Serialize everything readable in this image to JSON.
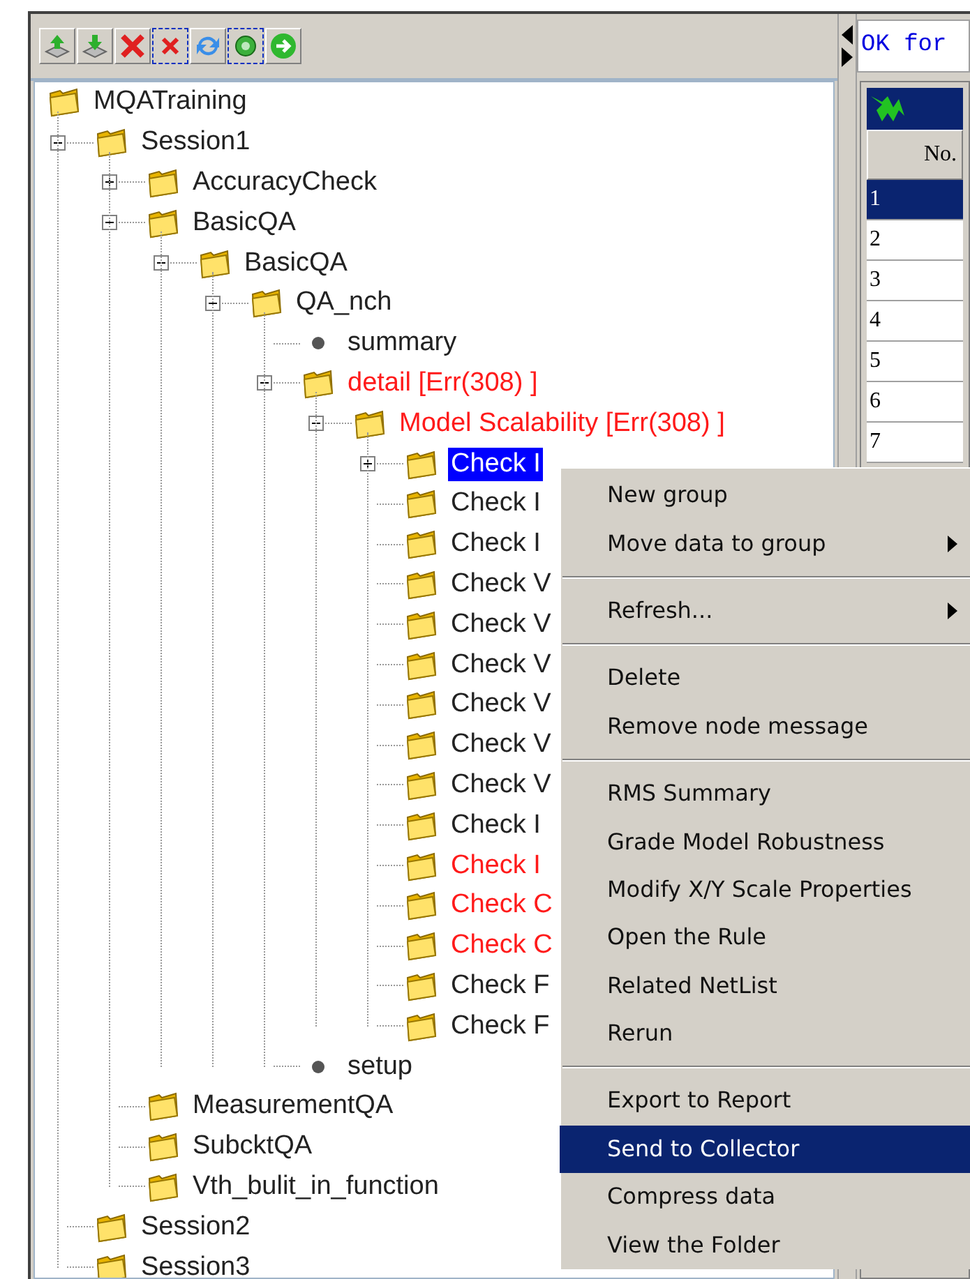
{
  "tree": [
    {
      "label": "MQATraining",
      "kind": "folder",
      "error": false,
      "children": [
        {
          "label": "Session1",
          "kind": "folder",
          "error": false,
          "expanded": true,
          "children": [
            {
              "label": "AccuracyCheck",
              "kind": "folder",
              "error": false,
              "expanded": false
            },
            {
              "label": "BasicQA",
              "kind": "folder",
              "error": false,
              "expanded": true,
              "children": [
                {
                  "label": "BasicQA",
                  "kind": "folder",
                  "error": false,
                  "expanded": true,
                  "children": [
                    {
                      "label": "QA_nch",
                      "kind": "folder",
                      "error": false,
                      "expanded": true,
                      "children": [
                        {
                          "label": "summary",
                          "kind": "leaf",
                          "error": false
                        },
                        {
                          "label": "detail [Err(308) ]",
                          "kind": "folder",
                          "error": true,
                          "expanded": true,
                          "children": [
                            {
                              "label": "Model Scalability [Err(308) ]",
                              "kind": "folder",
                              "error": true,
                              "expanded": true,
                              "children": [
                                {
                                  "label": "Check I",
                                  "kind": "folder",
                                  "error": false,
                                  "expanded": false,
                                  "selected": true
                                },
                                {
                                  "label": "Check I",
                                  "kind": "folder",
                                  "error": false,
                                  "selected": false
                                },
                                {
                                  "label": "Check I",
                                  "kind": "folder",
                                  "error": false,
                                  "selected": false
                                },
                                {
                                  "label": "Check V",
                                  "kind": "folder",
                                  "error": false,
                                  "selected": false
                                },
                                {
                                  "label": "Check V",
                                  "kind": "folder",
                                  "error": false,
                                  "selected": false
                                },
                                {
                                  "label": "Check V",
                                  "kind": "folder",
                                  "error": false,
                                  "selected": false
                                },
                                {
                                  "label": "Check V",
                                  "kind": "folder",
                                  "error": false,
                                  "selected": false
                                },
                                {
                                  "label": "Check V",
                                  "kind": "folder",
                                  "error": false,
                                  "selected": false
                                },
                                {
                                  "label": "Check V",
                                  "kind": "folder",
                                  "error": false,
                                  "selected": false
                                },
                                {
                                  "label": "Check I",
                                  "kind": "folder",
                                  "error": false,
                                  "selected": false
                                },
                                {
                                  "label": "Check I",
                                  "kind": "folder",
                                  "error": true,
                                  "selected": false
                                },
                                {
                                  "label": "Check C",
                                  "kind": "folder",
                                  "error": true,
                                  "selected": false
                                },
                                {
                                  "label": "Check C",
                                  "kind": "folder",
                                  "error": true,
                                  "selected": false
                                },
                                {
                                  "label": "Check F",
                                  "kind": "folder",
                                  "error": false,
                                  "selected": false
                                },
                                {
                                  "label": "Check F",
                                  "kind": "folder",
                                  "error": false,
                                  "selected": false
                                }
                              ]
                            }
                          ]
                        },
                        {
                          "label": "setup",
                          "kind": "leaf",
                          "error": false
                        }
                      ]
                    }
                  ]
                }
              ]
            },
            {
              "label": "MeasurementQA",
              "kind": "folder",
              "error": false
            },
            {
              "label": "SubcktQA",
              "kind": "folder",
              "error": false
            },
            {
              "label": "Vth_bulit_in_function",
              "kind": "folder",
              "error": false
            }
          ]
        },
        {
          "label": "Session2",
          "kind": "folder",
          "error": false
        },
        {
          "label": "Session3",
          "kind": "folder",
          "error": false
        }
      ]
    }
  ],
  "message": "OK for",
  "table": {
    "columns": [
      "No."
    ],
    "rows": [
      {
        "no": "1",
        "selected": true
      },
      {
        "no": "2",
        "selected": false
      },
      {
        "no": "3",
        "selected": false
      },
      {
        "no": "4",
        "selected": false
      },
      {
        "no": "5",
        "selected": false
      },
      {
        "no": "6",
        "selected": false
      },
      {
        "no": "7",
        "selected": false
      }
    ]
  },
  "context_menu": [
    {
      "kind": "item",
      "label": "New group",
      "submenu": false,
      "selected": false
    },
    {
      "kind": "item",
      "label": "Move data to group",
      "submenu": true,
      "selected": false
    },
    {
      "kind": "separator"
    },
    {
      "kind": "item",
      "label": "Refresh...",
      "submenu": true,
      "selected": false
    },
    {
      "kind": "separator"
    },
    {
      "kind": "item",
      "label": "Delete",
      "submenu": false,
      "selected": false
    },
    {
      "kind": "item",
      "label": "Remove node message",
      "submenu": false,
      "selected": false
    },
    {
      "kind": "separator"
    },
    {
      "kind": "item",
      "label": "RMS Summary",
      "submenu": false,
      "selected": false
    },
    {
      "kind": "item",
      "label": "Grade Model Robustness",
      "submenu": false,
      "selected": false
    },
    {
      "kind": "item",
      "label": "Modify X/Y Scale Properties",
      "submenu": false,
      "selected": false
    },
    {
      "kind": "item",
      "label": "Open the Rule",
      "submenu": false,
      "selected": false
    },
    {
      "kind": "item",
      "label": "Related NetList",
      "submenu": false,
      "selected": false
    },
    {
      "kind": "item",
      "label": "Rerun",
      "submenu": false,
      "selected": false
    },
    {
      "kind": "separator"
    },
    {
      "kind": "item",
      "label": "Export to Report",
      "submenu": false,
      "selected": false
    },
    {
      "kind": "item",
      "label": "Send to Collector",
      "submenu": false,
      "selected": true
    },
    {
      "kind": "item",
      "label": "Compress data",
      "submenu": false,
      "selected": false
    },
    {
      "kind": "item",
      "label": "View the Folder",
      "submenu": false,
      "selected": false
    }
  ]
}
